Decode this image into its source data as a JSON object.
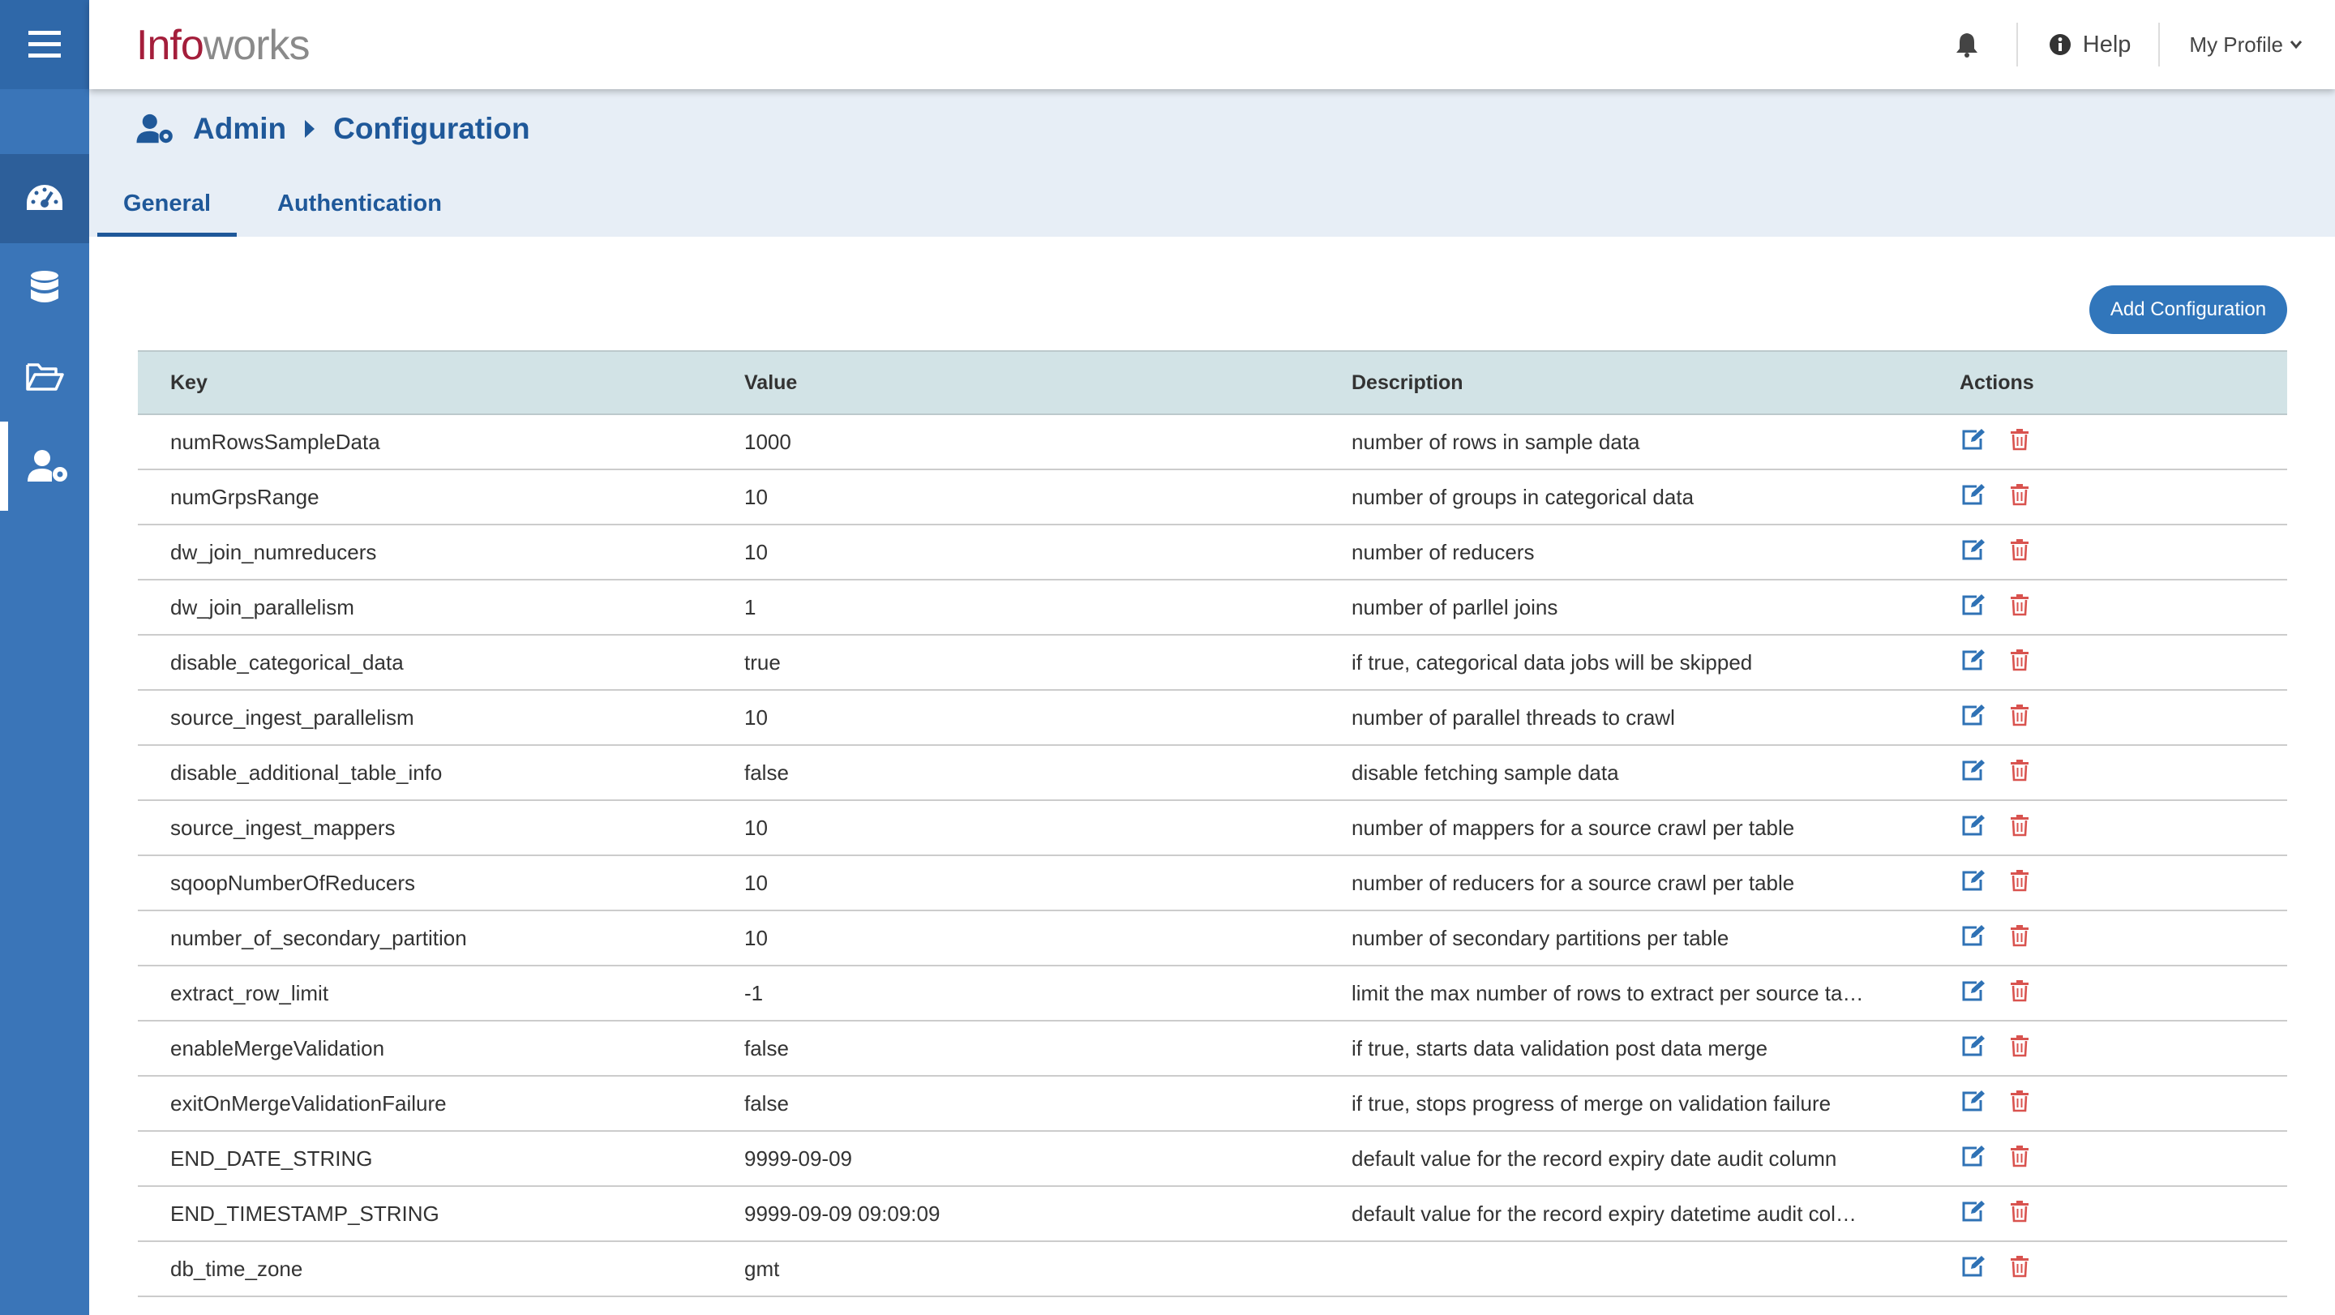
{
  "app": {
    "logo_part1": "Info",
    "logo_part2": "works"
  },
  "topbar": {
    "help_label": "Help",
    "profile_label": "My Profile"
  },
  "breadcrumb": {
    "root": "Admin",
    "current": "Configuration"
  },
  "tabs": [
    {
      "label": "General",
      "active": true
    },
    {
      "label": "Authentication",
      "active": false
    }
  ],
  "add_button_label": "Add Configuration",
  "table": {
    "headers": {
      "key": "Key",
      "value": "Value",
      "description": "Description",
      "actions": "Actions"
    },
    "rows": [
      {
        "key": "numRowsSampleData",
        "value": "1000",
        "description": "number of rows in sample data"
      },
      {
        "key": "numGrpsRange",
        "value": "10",
        "description": "number of groups in categorical data"
      },
      {
        "key": "dw_join_numreducers",
        "value": "10",
        "description": "number of reducers"
      },
      {
        "key": "dw_join_parallelism",
        "value": "1",
        "description": "number of parllel joins"
      },
      {
        "key": "disable_categorical_data",
        "value": "true",
        "description": "if true, categorical data jobs will be skipped"
      },
      {
        "key": "source_ingest_parallelism",
        "value": "10",
        "description": "number of parallel threads to crawl"
      },
      {
        "key": "disable_additional_table_info",
        "value": "false",
        "description": "disable fetching sample data"
      },
      {
        "key": "source_ingest_mappers",
        "value": "10",
        "description": "number of mappers for a source crawl per table"
      },
      {
        "key": "sqoopNumberOfReducers",
        "value": "10",
        "description": "number of reducers for a source crawl per table"
      },
      {
        "key": "number_of_secondary_partition",
        "value": "10",
        "description": "number of secondary partitions per table"
      },
      {
        "key": "extract_row_limit",
        "value": "-1",
        "description": "limit the max number of rows to extract per source ta…"
      },
      {
        "key": "enableMergeValidation",
        "value": "false",
        "description": "if true, starts data validation post data merge"
      },
      {
        "key": "exitOnMergeValidationFailure",
        "value": "false",
        "description": "if true, stops progress of merge on validation failure"
      },
      {
        "key": "END_DATE_STRING",
        "value": "9999-09-09",
        "description": "default value for the record expiry date audit column"
      },
      {
        "key": "END_TIMESTAMP_STRING",
        "value": "9999-09-09 09:09:09",
        "description": "default value for the record expiry datetime audit col…"
      },
      {
        "key": "db_time_zone",
        "value": "gmt",
        "description": ""
      }
    ]
  },
  "colors": {
    "sidebar": "#3a75b8",
    "brand_red": "#a41e3b",
    "accent_blue": "#1f5899",
    "header_band": "#e7eef6",
    "table_header": "#d2e3e6",
    "edit_icon": "#2f72b5",
    "delete_icon": "#d9534f"
  }
}
